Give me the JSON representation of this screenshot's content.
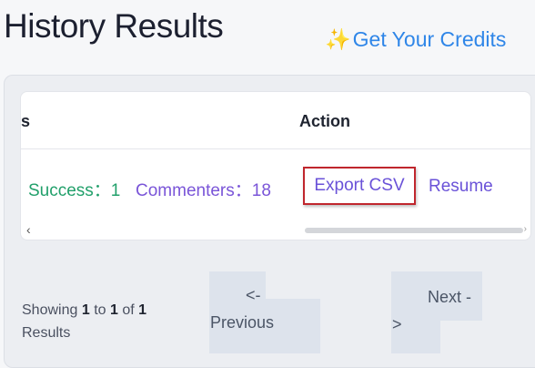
{
  "page": {
    "title": "History Results"
  },
  "credits": {
    "icon": "sparkles-icon",
    "icon_glyph": "✨",
    "label": "Get Your Credits"
  },
  "table": {
    "headers": {
      "status_partial": "s",
      "action": "Action"
    },
    "row": {
      "success": "Success：1",
      "commenters": "Commenters：18",
      "export": "Export CSV",
      "resume": "Resume"
    },
    "scroll": {
      "left": "‹",
      "right": "›"
    }
  },
  "pagination": {
    "showing_prefix": "Showing",
    "from": "1",
    "to_word": "to",
    "to": "1",
    "of_word": "of",
    "total": "1",
    "results_word": "Results",
    "prev_arrow": "<-",
    "prev_label": "Previous",
    "next_label": "Next -",
    "next_arrow": ">"
  },
  "colors": {
    "success": "#22a06b",
    "accent": "#6a52d8",
    "link": "#2f86e8",
    "highlight_border": "#c0262d"
  }
}
